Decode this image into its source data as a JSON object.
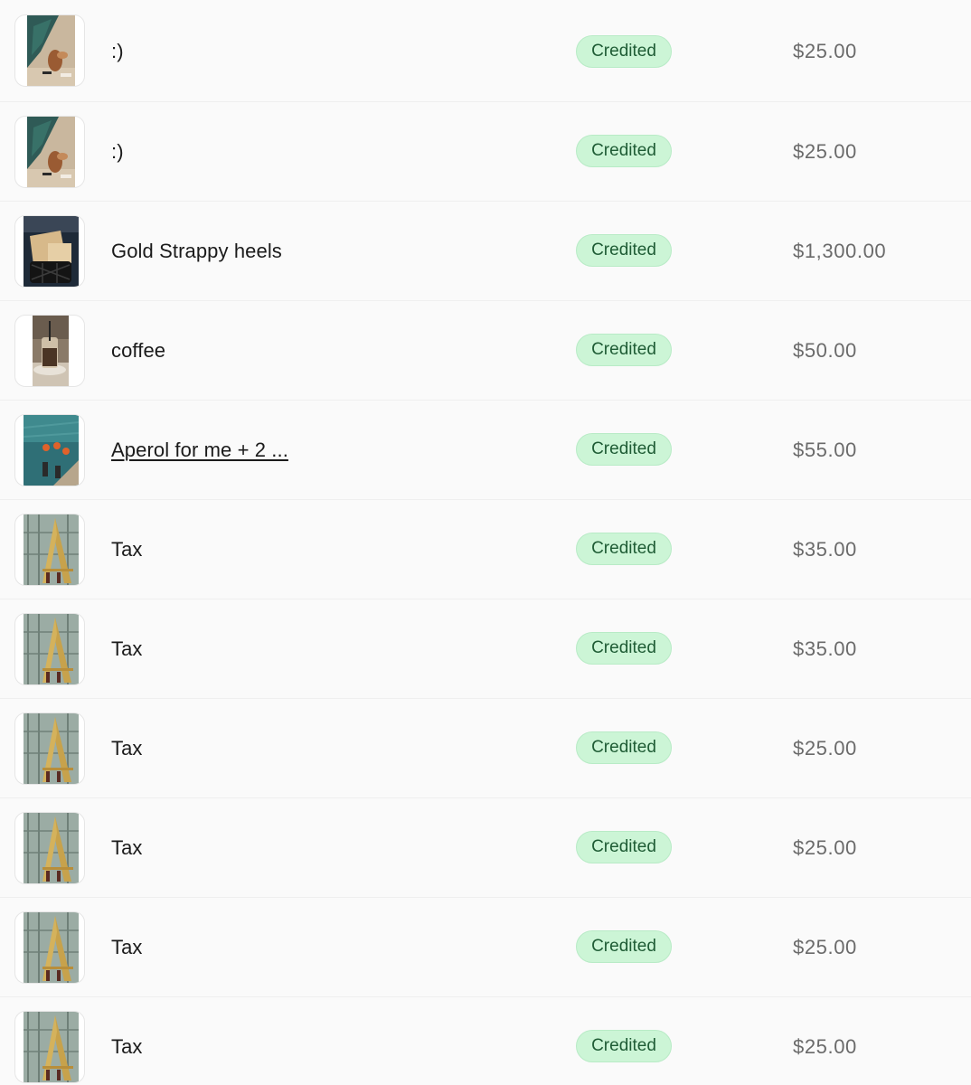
{
  "transactions": [
    {
      "title": ":)",
      "status": "Credited",
      "amount": "$25.00",
      "thumbnail": "pool-photo",
      "link": false
    },
    {
      "title": ":)",
      "status": "Credited",
      "amount": "$25.00",
      "thumbnail": "pool-photo",
      "link": false
    },
    {
      "title": "Gold Strappy heels",
      "status": "Credited",
      "amount": "$1,300.00",
      "thumbnail": "shopping-bag-photo",
      "link": false
    },
    {
      "title": "coffee",
      "status": "Credited",
      "amount": "$50.00",
      "thumbnail": "iced-coffee-photo",
      "link": false
    },
    {
      "title": "Aperol for me + 2 ...",
      "status": "Credited",
      "amount": "$55.00",
      "thumbnail": "seaside-drinks-photo",
      "link": true
    },
    {
      "title": "Tax",
      "status": "Credited",
      "amount": "$35.00",
      "thumbnail": "building-photo",
      "link": false
    },
    {
      "title": "Tax",
      "status": "Credited",
      "amount": "$35.00",
      "thumbnail": "building-photo",
      "link": false
    },
    {
      "title": "Tax",
      "status": "Credited",
      "amount": "$25.00",
      "thumbnail": "building-photo",
      "link": false
    },
    {
      "title": "Tax",
      "status": "Credited",
      "amount": "$25.00",
      "thumbnail": "building-photo",
      "link": false
    },
    {
      "title": "Tax",
      "status": "Credited",
      "amount": "$25.00",
      "thumbnail": "building-photo",
      "link": false
    },
    {
      "title": "Tax",
      "status": "Credited",
      "amount": "$25.00",
      "thumbnail": "building-photo",
      "link": false
    }
  ],
  "colors": {
    "badge_bg": "#ccf5d6",
    "badge_text": "#1f5c35",
    "amount_text": "#6a6a6a",
    "title_text": "#1b1b1b"
  }
}
